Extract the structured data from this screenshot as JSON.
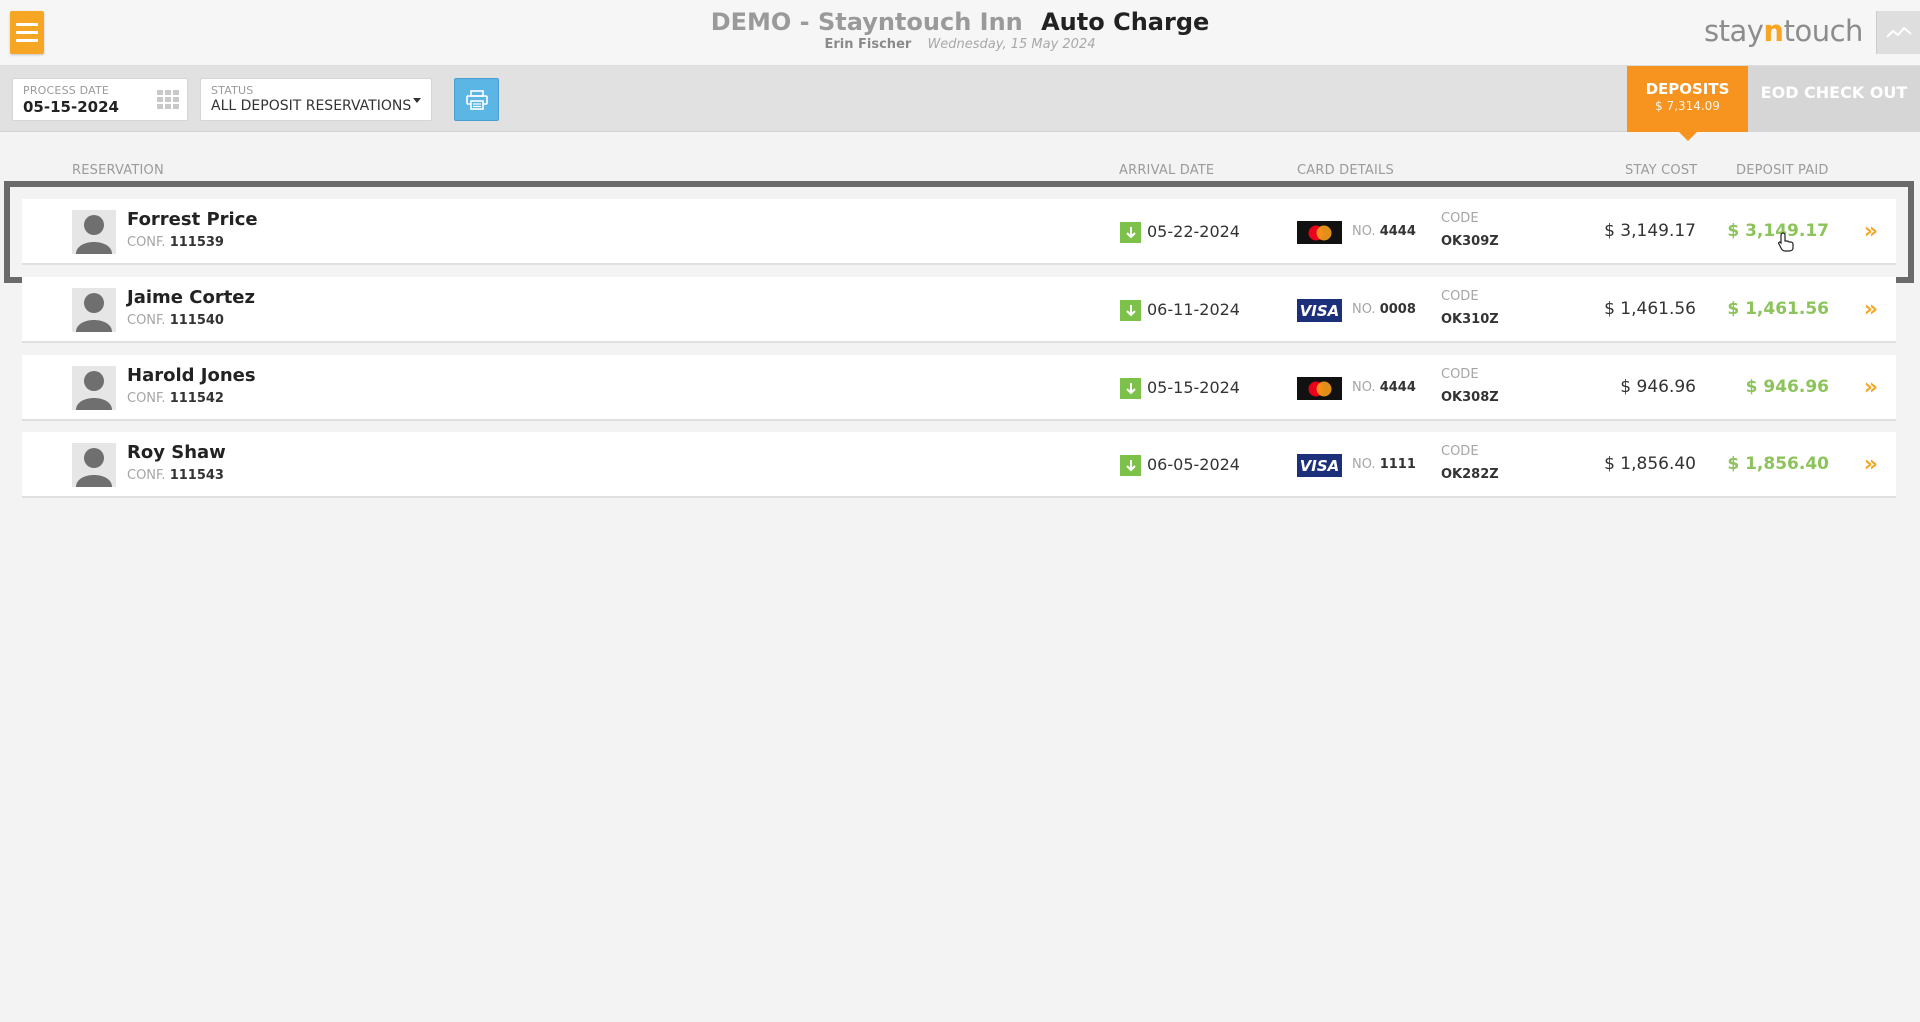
{
  "header": {
    "hotel_name": "DEMO - Stayntouch Inn",
    "page_title": "Auto Charge",
    "user_name": "Erin Fischer",
    "date": "Wednesday, 15 May 2024",
    "logo_prefix": "stay",
    "logo_accent": "n",
    "logo_suffix": "touch"
  },
  "toolbar": {
    "process_date_label": "PROCESS DATE",
    "process_date_value": "05-15-2024",
    "status_label": "STATUS",
    "status_value": "ALL DEPOSIT RESERVATIONS",
    "tabs": [
      {
        "label": "DEPOSITS",
        "amount": "$ 7,314.09",
        "active": true
      },
      {
        "label": "EOD CHECK OUT",
        "active": false
      }
    ]
  },
  "columns": {
    "reservation": "RESERVATION",
    "arrival_date": "ARRIVAL DATE",
    "card_details": "CARD DETAILS",
    "stay_cost": "STAY COST",
    "deposit_paid": "DEPOSIT PAID"
  },
  "rows": [
    {
      "name": "Forrest Price",
      "conf_label": "CONF.",
      "conf": "111539",
      "arrival": "05-22-2024",
      "card_type": "mastercard",
      "no_label": "NO.",
      "card_no": "4444",
      "code_label": "CODE",
      "code": "OK309Z",
      "stay_cost": "$ 3,149.17",
      "deposit_paid": "$ 3,149.17"
    },
    {
      "name": "Jaime Cortez",
      "conf_label": "CONF.",
      "conf": "111540",
      "arrival": "06-11-2024",
      "card_type": "visa",
      "visa_text": "VISA",
      "no_label": "NO.",
      "card_no": "0008",
      "code_label": "CODE",
      "code": "OK310Z",
      "stay_cost": "$ 1,461.56",
      "deposit_paid": "$ 1,461.56"
    },
    {
      "name": "Harold Jones",
      "conf_label": "CONF.",
      "conf": "111542",
      "arrival": "05-15-2024",
      "card_type": "mastercard",
      "no_label": "NO.",
      "card_no": "4444",
      "code_label": "CODE",
      "code": "OK308Z",
      "stay_cost": "$ 946.96",
      "deposit_paid": "$ 946.96"
    },
    {
      "name": "Roy Shaw",
      "conf_label": "CONF.",
      "conf": "111543",
      "arrival": "06-05-2024",
      "card_type": "visa",
      "visa_text": "VISA",
      "no_label": "NO.",
      "card_no": "1111",
      "code_label": "CODE",
      "code": "OK282Z",
      "stay_cost": "$ 1,856.40",
      "deposit_paid": "$ 1,856.40"
    }
  ],
  "colors": {
    "accent_orange": "#f6941f",
    "deposit_green": "#8cc35a",
    "arrival_green": "#7cc24a",
    "print_blue": "#5bb6e6"
  },
  "icons": [
    "menu-icon",
    "analytics-icon",
    "calendar-icon",
    "print-icon",
    "avatar-icon",
    "arrival-icon",
    "mastercard-icon",
    "visa-icon",
    "chevron-double-right-icon"
  ]
}
